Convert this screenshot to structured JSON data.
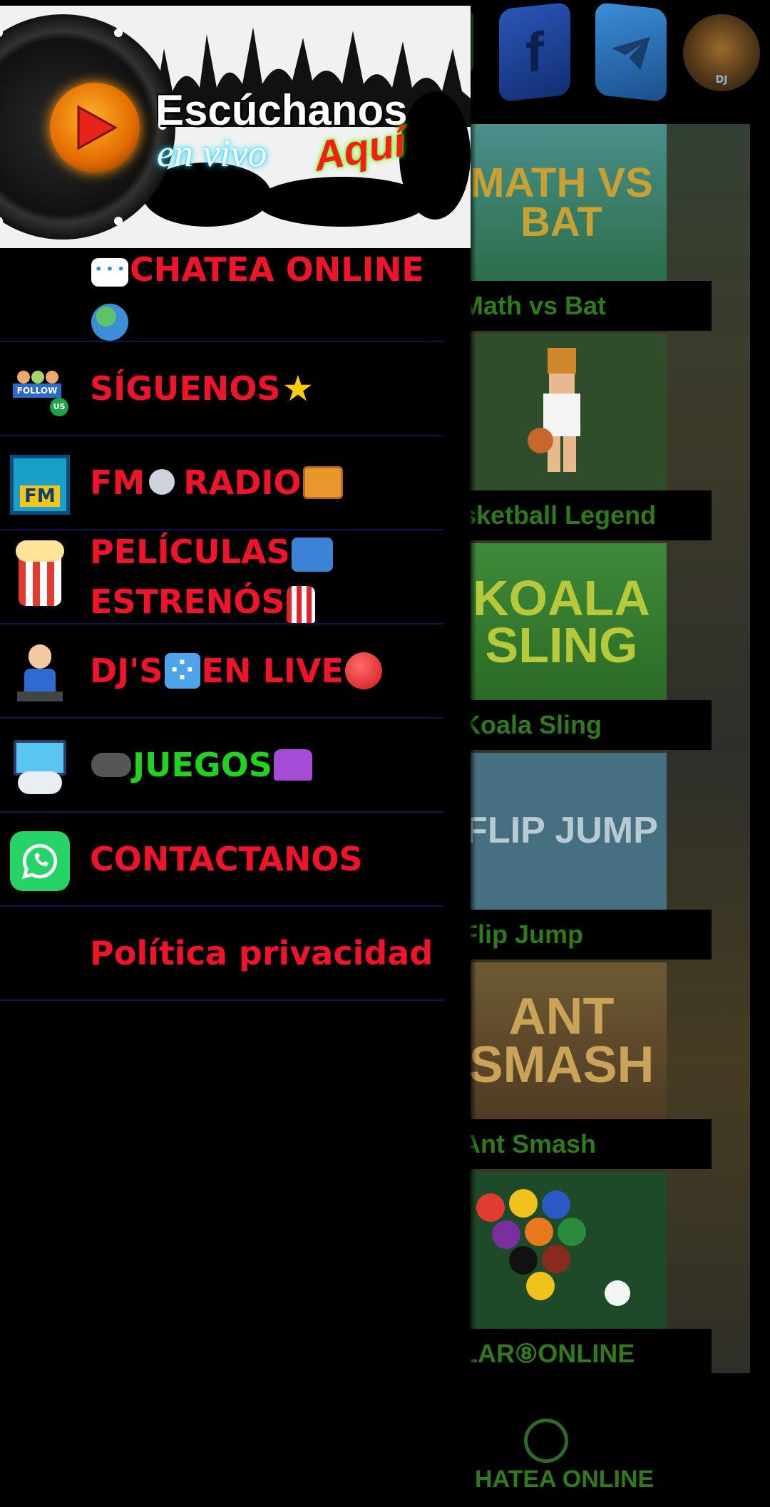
{
  "banner": {
    "line1": "Escúchanos",
    "line2": "en vivo",
    "line3": "Aquí"
  },
  "menu": {
    "items": [
      {
        "prefix": "",
        "label": "CHATEA ONLINE",
        "icon": "chat-bubble-icon",
        "color": "#f0132a"
      },
      {
        "label": "SÍGUENOS",
        "icon": "follow-us-icon",
        "color": "#f0132a"
      },
      {
        "label_a": "FM",
        "label_b": "RADIO",
        "icon": "fm-radio-icon",
        "color": "#f0132a"
      },
      {
        "label_a": "PELÍCULAS",
        "label_b": "ESTRENÓS",
        "icon": "popcorn-icon",
        "color": "#f0132a"
      },
      {
        "label_a": "DJ'S",
        "label_b": "EN LIVE",
        "icon": "dj-icon",
        "color": "#f0132a"
      },
      {
        "label": "JUEGOS",
        "icon": "game-console-icon",
        "color": "#1ed41e"
      },
      {
        "label": "CONTACTANOS",
        "icon": "whatsapp-icon",
        "color": "#f0132a"
      },
      {
        "label": "Política privacidad",
        "color": "#f0132a"
      }
    ]
  },
  "background": {
    "top_icons": [
      "facebook-icon",
      "telegram-icon",
      "dj-avatar-icon"
    ],
    "avatar_text": "DJ",
    "facebook_letter": "f",
    "games": [
      {
        "thumb_text": "MATH VS BAT",
        "label": "Math vs Bat"
      },
      {
        "thumb_text": "",
        "label": "sketball Legend"
      },
      {
        "thumb_text": "KOALA SLING",
        "label": "Koala Sling"
      },
      {
        "thumb_text": "FLIP JUMP",
        "label": "Flip Jump"
      },
      {
        "thumb_text": "ANT SMASH",
        "label": "Ant Smash"
      },
      {
        "thumb_text": "",
        "label": "LAR⑧ONLINE"
      }
    ],
    "bottom_chat": "HATEA ONLINE"
  },
  "colors": {
    "menu_text": "#f0132a",
    "menu_text_green": "#1ed41e",
    "divider": "#141455",
    "game_label": "#2f7a1a"
  }
}
